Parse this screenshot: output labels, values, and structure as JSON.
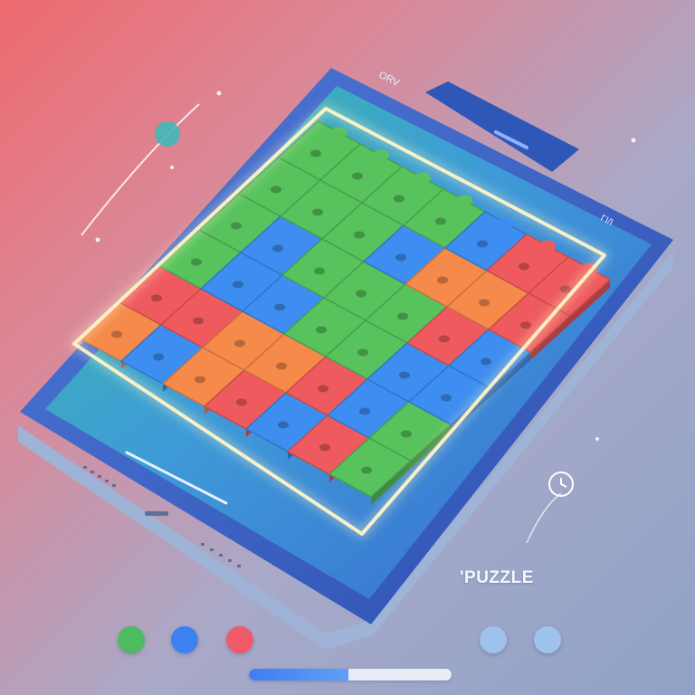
{
  "status_bar": {
    "top_label": "ORV",
    "side_label": "ΓΙ/Ι"
  },
  "caption": "'PUZZLE",
  "colors": {
    "red": "#ef5a5e",
    "orange": "#f58a4a",
    "green": "#58c25d",
    "blue": "#3d8ef0",
    "accent_glow": "#fff6c8"
  },
  "board": {
    "rows": [
      [
        "orange",
        "red",
        "green",
        "green",
        "green",
        "green"
      ],
      [
        "blue",
        "red",
        "blue",
        "blue",
        "green",
        "green"
      ],
      [
        "orange",
        "orange",
        "blue",
        "green",
        "green",
        "green"
      ],
      [
        "red",
        "orange",
        "green",
        "green",
        "blue",
        "green"
      ],
      [
        "blue",
        "red",
        "green",
        "green",
        "orange",
        "blue"
      ],
      [
        "red",
        "blue",
        "blue",
        "red",
        "orange",
        "red"
      ],
      [
        "green",
        "green",
        "blue",
        "blue",
        "red",
        "red"
      ]
    ]
  },
  "indicator_dots": [
    {
      "name": "green-dot",
      "color": "#4dbb5f"
    },
    {
      "name": "blue-dot",
      "color": "#3b82f0"
    },
    {
      "name": "red-dot",
      "color": "#ef5a6a"
    },
    {
      "name": "light-blue-dot-1",
      "color": "#9fc2ea"
    },
    {
      "name": "light-blue-dot-2",
      "color": "#9fc2ea"
    }
  ],
  "progress": {
    "fraction": 0.49
  }
}
